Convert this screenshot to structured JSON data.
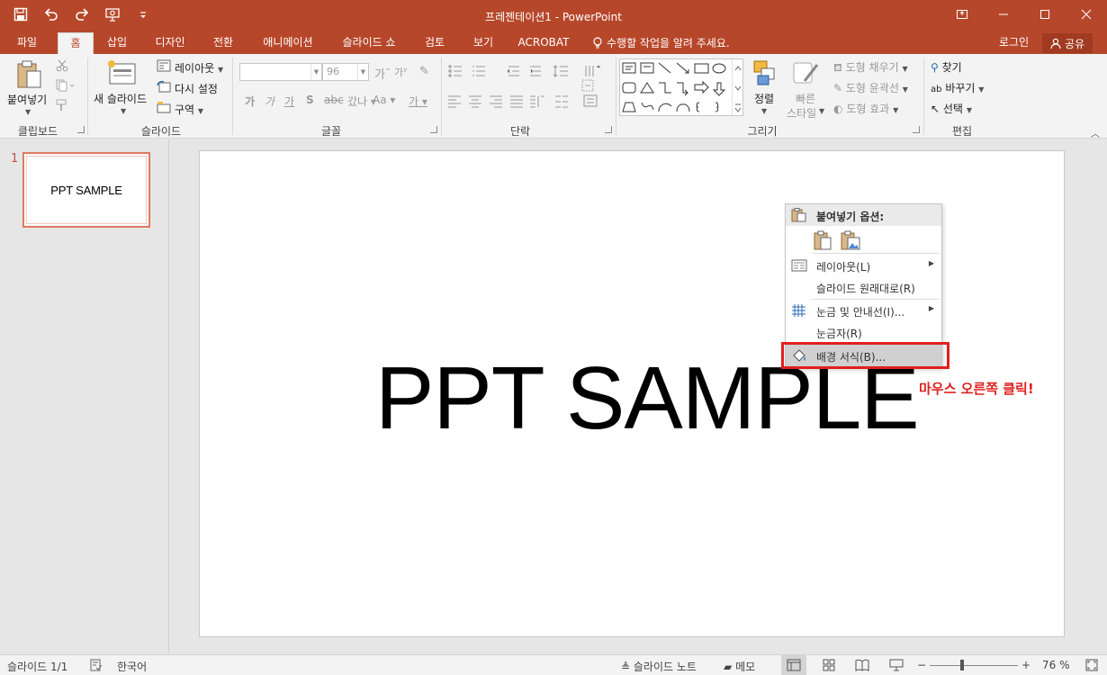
{
  "app": {
    "window_title": "프레젠테이션1 - PowerPoint",
    "accent_color": "#b7472a"
  },
  "quick_access": {
    "icons": [
      "save-icon",
      "undo-icon",
      "redo-icon",
      "slideshow-icon",
      "customize-icon"
    ]
  },
  "tabs": [
    {
      "label": "파일"
    },
    {
      "label": "홈"
    },
    {
      "label": "삽입"
    },
    {
      "label": "디자인"
    },
    {
      "label": "전환"
    },
    {
      "label": "애니메이션"
    },
    {
      "label": "슬라이드 쇼"
    },
    {
      "label": "검토"
    },
    {
      "label": "보기"
    },
    {
      "label": "ACROBAT"
    }
  ],
  "active_tab": "홈",
  "tell_me": "수행할 작업을 알려 주세요.",
  "account": {
    "login": "로그인",
    "share": "공유"
  },
  "ribbon": {
    "clipboard": {
      "group": "클립보드",
      "paste": "붙여넣기"
    },
    "slides": {
      "group": "슬라이드",
      "new_slide": "새 슬라이드",
      "layout": "레이아웃",
      "reset": "다시 설정",
      "section": "구역"
    },
    "font": {
      "group": "글꼴",
      "font_name": "",
      "font_size": "96"
    },
    "paragraph": {
      "group": "단락"
    },
    "drawing": {
      "group": "그리기",
      "arrange": "정렬",
      "quick_styles_1": "빠른",
      "quick_styles_2": "스타일",
      "shape_fill": "도형 채우기",
      "shape_outline": "도형 윤곽선",
      "shape_effects": "도형 효과"
    },
    "editing": {
      "group": "편집",
      "find": "찾기",
      "replace": "바꾸기",
      "select": "선택"
    }
  },
  "thumbnails": [
    {
      "number": "1",
      "text": "PPT SAMPLE"
    }
  ],
  "slide": {
    "title": "PPT SAMPLE"
  },
  "context_menu": {
    "paste_options": "붙여넣기 옵션:",
    "items": [
      {
        "label": "레이아웃(L)"
      },
      {
        "label": "슬라이드 원래대로(R)"
      },
      {
        "label": "눈금 및 안내선(I)..."
      },
      {
        "label": "눈금자(R)"
      },
      {
        "label": "배경 서식(B)..."
      }
    ]
  },
  "annotation": "마우스 오른쪽 클릭!",
  "status": {
    "slide_counter": "슬라이드 1/1",
    "language": "한국어",
    "notes": "슬라이드 노트",
    "comments": "메모",
    "zoom": "76 %"
  }
}
